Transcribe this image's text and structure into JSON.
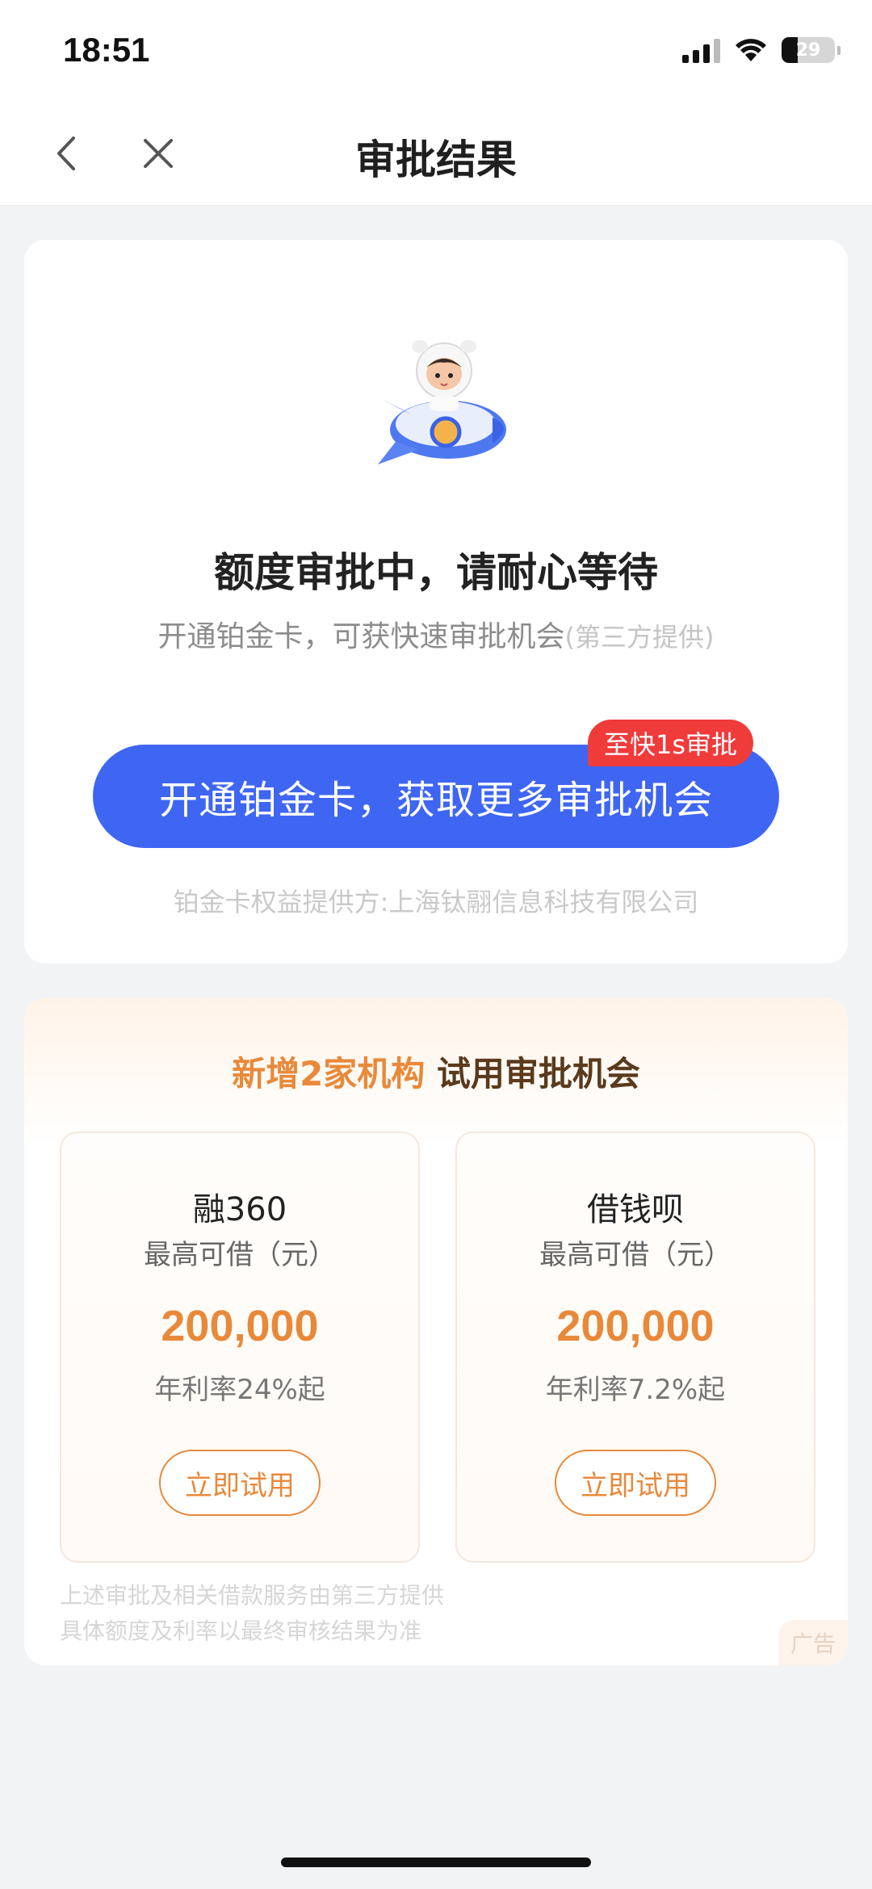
{
  "status_bar": {
    "time": "18:51",
    "battery": "29"
  },
  "nav": {
    "title": "审批结果",
    "back_icon": "chevron-left-icon",
    "close_icon": "close-icon"
  },
  "approval": {
    "title": "额度审批中，请耐心等待",
    "subtitle": "开通铂金卡，可获快速审批机会",
    "subtitle_note": "(第三方提供)",
    "cta_label": "开通铂金卡，获取更多审批机会",
    "cta_badge": "至快1s审批",
    "provider_text": "铂金卡权益提供方:上海钛翮信息科技有限公司",
    "colors": {
      "cta": "#3f66f2",
      "badge": "#f03b3b"
    }
  },
  "offers_section": {
    "title_highlight": "新增2家机构",
    "title_rest": "试用审批机会",
    "offers": [
      {
        "name": "融360",
        "subtitle": "最高可借（元）",
        "amount": "200,000",
        "rate": "年利率24%起",
        "button": "立即试用"
      },
      {
        "name": "借钱呗",
        "subtitle": "最高可借（元）",
        "amount": "200,000",
        "rate": "年利率7.2%起",
        "button": "立即试用"
      }
    ],
    "disclaimer_line1": "上述审批及相关借款服务由第三方提供",
    "disclaimer_line2": "具体额度及利率以最终审核结果为准",
    "ad_tag": "广告",
    "accent_color": "#e8893a"
  }
}
